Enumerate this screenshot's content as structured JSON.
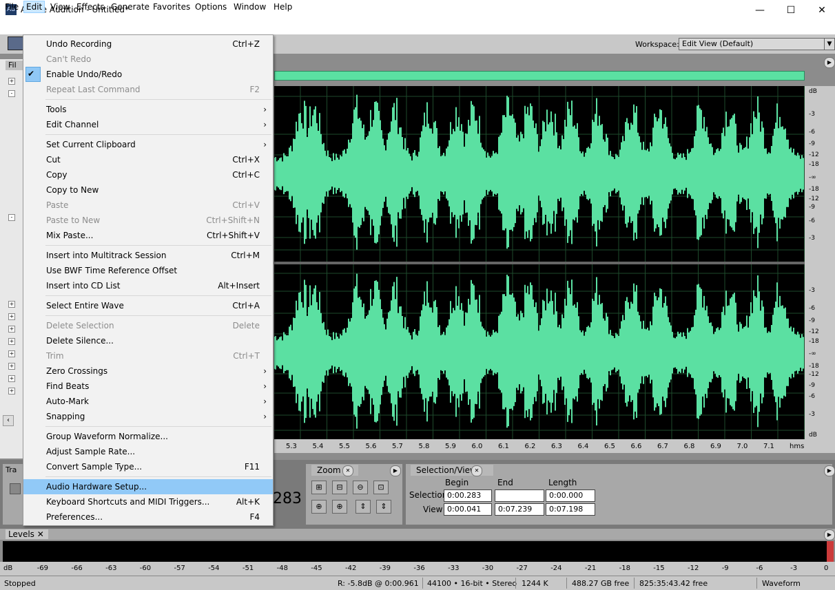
{
  "window": {
    "icon_text": "Au",
    "title": "Adobe Audition - Untitled*",
    "minimize": "—",
    "maximize": "☐",
    "close": "✕"
  },
  "menubar": [
    "File",
    "Edit",
    "View",
    "Effects",
    "Generate",
    "Favorites",
    "Options",
    "Window",
    "Help"
  ],
  "workspace": {
    "label": "Workspace:",
    "value": "Edit View (Default)",
    "arrow": "▼"
  },
  "files_tab": "Fil",
  "edit_menu": [
    {
      "label": "Undo Recording",
      "shortcut": "Ctrl+Z"
    },
    {
      "label": "Can't Redo",
      "shortcut": "",
      "disabled": true
    },
    {
      "label": "Enable Undo/Redo",
      "shortcut": "",
      "checked": true
    },
    {
      "label": "Repeat Last Command",
      "shortcut": "F2",
      "disabled": true
    },
    {
      "sep": true
    },
    {
      "label": "Tools",
      "submenu": true
    },
    {
      "label": "Edit Channel",
      "submenu": true
    },
    {
      "sep": true
    },
    {
      "label": "Set Current Clipboard",
      "submenu": true
    },
    {
      "label": "Cut",
      "shortcut": "Ctrl+X"
    },
    {
      "label": "Copy",
      "shortcut": "Ctrl+C"
    },
    {
      "label": "Copy to New",
      "shortcut": ""
    },
    {
      "label": "Paste",
      "shortcut": "Ctrl+V",
      "disabled": true
    },
    {
      "label": "Paste to New",
      "shortcut": "Ctrl+Shift+N",
      "disabled": true
    },
    {
      "label": "Mix Paste...",
      "shortcut": "Ctrl+Shift+V"
    },
    {
      "sep": true
    },
    {
      "label": "Insert into Multitrack Session",
      "shortcut": "Ctrl+M"
    },
    {
      "label": "Use BWF Time Reference Offset",
      "shortcut": ""
    },
    {
      "label": "Insert into CD List",
      "shortcut": "Alt+Insert"
    },
    {
      "sep": true
    },
    {
      "label": "Select Entire Wave",
      "shortcut": "Ctrl+A"
    },
    {
      "sep": true
    },
    {
      "label": "Delete Selection",
      "shortcut": "Delete",
      "disabled": true
    },
    {
      "label": "Delete Silence...",
      "shortcut": ""
    },
    {
      "label": "Trim",
      "shortcut": "Ctrl+T",
      "disabled": true
    },
    {
      "label": "Zero Crossings",
      "submenu": true
    },
    {
      "label": "Find Beats",
      "submenu": true
    },
    {
      "label": "Auto-Mark",
      "submenu": true
    },
    {
      "label": "Snapping",
      "submenu": true
    },
    {
      "sep": true
    },
    {
      "label": "Group Waveform Normalize...",
      "shortcut": ""
    },
    {
      "label": "Adjust Sample Rate...",
      "shortcut": ""
    },
    {
      "label": "Convert Sample Type...",
      "shortcut": "F11"
    },
    {
      "sep": true
    },
    {
      "label": "Audio Hardware Setup...",
      "shortcut": "",
      "highlighted": true
    },
    {
      "label": "Keyboard Shortcuts and MIDI Triggers...",
      "shortcut": "Alt+K"
    },
    {
      "label": "Preferences...",
      "shortcut": "F4"
    }
  ],
  "db_ruler_top": [
    "dB",
    "-3",
    "-6",
    "-9",
    "-12",
    "-18",
    "-∞",
    "-18",
    "-12",
    "-9",
    "-6",
    "-3"
  ],
  "db_ruler_bottom": [
    "-3",
    "-6",
    "-9",
    "-12",
    "-18",
    "-∞",
    "-18",
    "-12",
    "-9",
    "-6",
    "-3",
    "dB"
  ],
  "time_ticks": [
    "5.3",
    "5.4",
    "5.5",
    "5.6",
    "5.7",
    "5.8",
    "5.9",
    "6.0",
    "6.1",
    "6.2",
    "6.3",
    "6.4",
    "6.5",
    "6.6",
    "6.7",
    "6.8",
    "6.9",
    "7.0",
    "7.1",
    "hms"
  ],
  "transport": {
    "tab": "Tra",
    "time_suffix": "283"
  },
  "zoom": {
    "tab": "Zoom"
  },
  "selection_view": {
    "tab": "Selection/View",
    "headers": [
      "Begin",
      "End",
      "Length"
    ],
    "rows": [
      {
        "label": "Selection",
        "begin": "0:00.283",
        "end": "",
        "length": "0:00.000"
      },
      {
        "label": "View",
        "begin": "0:00.041",
        "end": "0:07.239",
        "length": "0:07.198"
      }
    ]
  },
  "levels": {
    "tab": "Levels",
    "scale": [
      "dB",
      "-69",
      "-66",
      "-63",
      "-60",
      "-57",
      "-54",
      "-51",
      "-48",
      "-45",
      "-42",
      "-39",
      "-36",
      "-33",
      "-30",
      "-27",
      "-24",
      "-21",
      "-18",
      "-15",
      "-12",
      "-9",
      "-6",
      "-3",
      "0"
    ]
  },
  "status": {
    "state": "Stopped",
    "level": "R: -5.8dB @  0:00.961",
    "format": "44100 • 16-bit • Stereo",
    "size": "1244 K",
    "free": "488.27 GB free",
    "free_time": "825:35:43.42 free",
    "view": "Waveform"
  },
  "colors": {
    "waveform": "#5be0a2",
    "menu_highlight": "#91c9f7",
    "level_peak": "#cc3b3b"
  }
}
